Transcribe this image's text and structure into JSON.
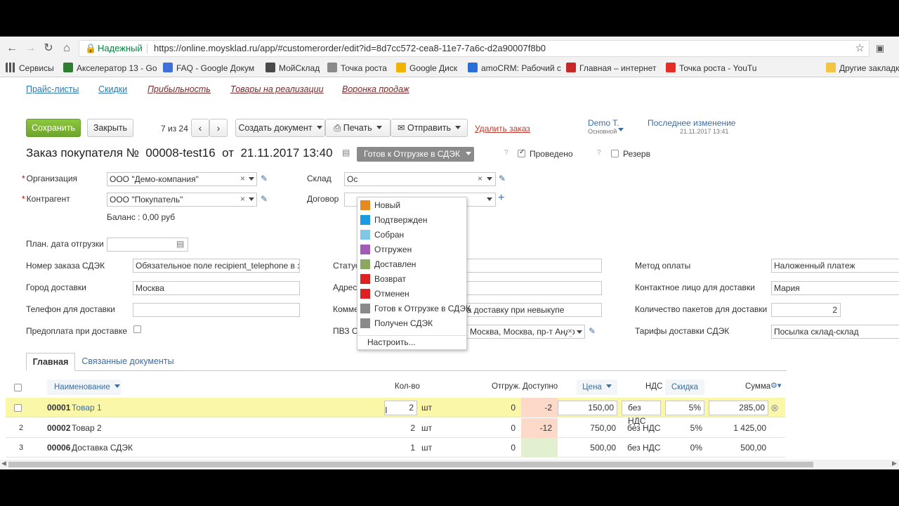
{
  "browser": {
    "secure_label": "Надежный",
    "url": "https://online.moysklad.ru/app/#customerorder/edit?id=8d7cc572-cea8-11e7-7a6c-d2a90007f8b0",
    "apps_label": "Сервисы",
    "bookmarks": [
      {
        "label": "Акселератор 13 - Go",
        "color": "#2e7d32"
      },
      {
        "label": "FAQ - Google Докум",
        "color": "#3f6fd8"
      },
      {
        "label": "МойСклад",
        "color": "#4a4a4a"
      },
      {
        "label": "Точка роста",
        "color": "#8a8a8a"
      },
      {
        "label": "Google Диск",
        "color": "#f2b300"
      },
      {
        "label": "amoCRM: Рабочий с",
        "color": "#2b6fd6"
      },
      {
        "label": "Главная – интернет",
        "color": "#c62828"
      },
      {
        "label": "Точка роста - YouTu",
        "color": "#e52d27"
      }
    ],
    "other_bookmarks": "Другие закладки"
  },
  "nav": {
    "tabs": [
      "Прайс-листы",
      "Скидки",
      "Прибыльность",
      "Товары на реализации",
      "Воронка продаж"
    ]
  },
  "toolbar": {
    "save": "Сохранить",
    "close": "Закрыть",
    "pager": "7 из 24",
    "create_doc": "Создать документ",
    "print": "Печать",
    "send": "Отправить",
    "delete": "Удалить заказ",
    "owner": "Demo T.",
    "owner_sub": "Основной",
    "last_change_label": "Последнее изменение",
    "last_change_date": "21.11.2017 13:41"
  },
  "order": {
    "title_prefix": "Заказ покупателя №",
    "number": "00008-test16",
    "from": "от",
    "date": "21.11.2017 13:40",
    "status": "Готов к Отгрузке в СДЭК",
    "posted_label": "Проведено",
    "reserve_label": "Резерв",
    "help": "?"
  },
  "status_menu": {
    "items": [
      {
        "label": "Новый",
        "color": "#e8891d"
      },
      {
        "label": "Подтвержден",
        "color": "#1a9be0"
      },
      {
        "label": "Собран",
        "color": "#7ec7e8"
      },
      {
        "label": "Отгружен",
        "color": "#a35ab8"
      },
      {
        "label": "Доставлен",
        "color": "#8aa860"
      },
      {
        "label": "Возврат",
        "color": "#e02020"
      },
      {
        "label": "Отменен",
        "color": "#e02020"
      },
      {
        "label": "Готов к Отгрузке в СДЭК",
        "color": "#8a8a8a"
      },
      {
        "label": "Получен СДЭК",
        "color": "#8a8a8a"
      }
    ],
    "configure": "Настроить..."
  },
  "form": {
    "org_label": "Организация",
    "org_value": "ООО \"Демо-компания\"",
    "counterparty_label": "Контрагент",
    "counterparty_value": "ООО \"Покупатель\"",
    "balance": "Баланс : 0,00 руб",
    "warehouse_label": "Склад",
    "warehouse_value": "Ос",
    "contract_label": "Договор",
    "ship_date_label": "План. дата отгрузки",
    "cdek_order_label": "Номер заказа СДЭК",
    "cdek_order_value": "Обязательное поле recipient_telephone в за",
    "city_label": "Город доставки",
    "city_value": "Москва",
    "phone_label": "Телефон для доставки",
    "prepay_label": "Предоплата при доставке",
    "status_label": "Статус",
    "address_label": "Адрес",
    "comment_label": "Комме",
    "comment_value": "ть за доставку при невыкупе",
    "pvz_label": "ПВЗ СДЭК",
    "pvz_value": "Россия, Москва, Москва, пр-т Андр",
    "payment_label": "Метод оплаты",
    "payment_value": "Наложенный платеж",
    "contact_label": "Контактное лицо для доставки",
    "contact_value": "Мария",
    "packages_label": "Количество пакетов для доставки",
    "packages_value": "2",
    "tariff_label": "Тарифы доставки СДЭК",
    "tariff_value": "Посылка склад-склад"
  },
  "tabs2": {
    "main": "Главная",
    "related": "Связанные документы"
  },
  "table": {
    "headers": {
      "name": "Наименование",
      "qty": "Кол-во",
      "shipped": "Отгруж.",
      "available": "Доступно",
      "price": "Цена",
      "vat": "НДС",
      "discount": "Скидка",
      "sum": "Сумма"
    },
    "rows": [
      {
        "num": "",
        "code": "00001",
        "name": "Товар 1",
        "qty": "2",
        "unit": "шт",
        "shipped": "0",
        "available": "-2",
        "price": "150,00",
        "vat": "без НДС",
        "discount": "5%",
        "sum": "285,00"
      },
      {
        "num": "2",
        "code": "00002",
        "name": "Товар 2",
        "qty": "2",
        "unit": "шт",
        "shipped": "0",
        "available": "-12",
        "price": "750,00",
        "vat": "без НДС",
        "discount": "5%",
        "sum": "1 425,00"
      },
      {
        "num": "3",
        "code": "00006",
        "name": "Доставка СДЭК",
        "qty": "1",
        "unit": "шт",
        "shipped": "0",
        "available": "",
        "price": "500,00",
        "vat": "без НДС",
        "discount": "0%",
        "sum": "500,00"
      }
    ]
  }
}
